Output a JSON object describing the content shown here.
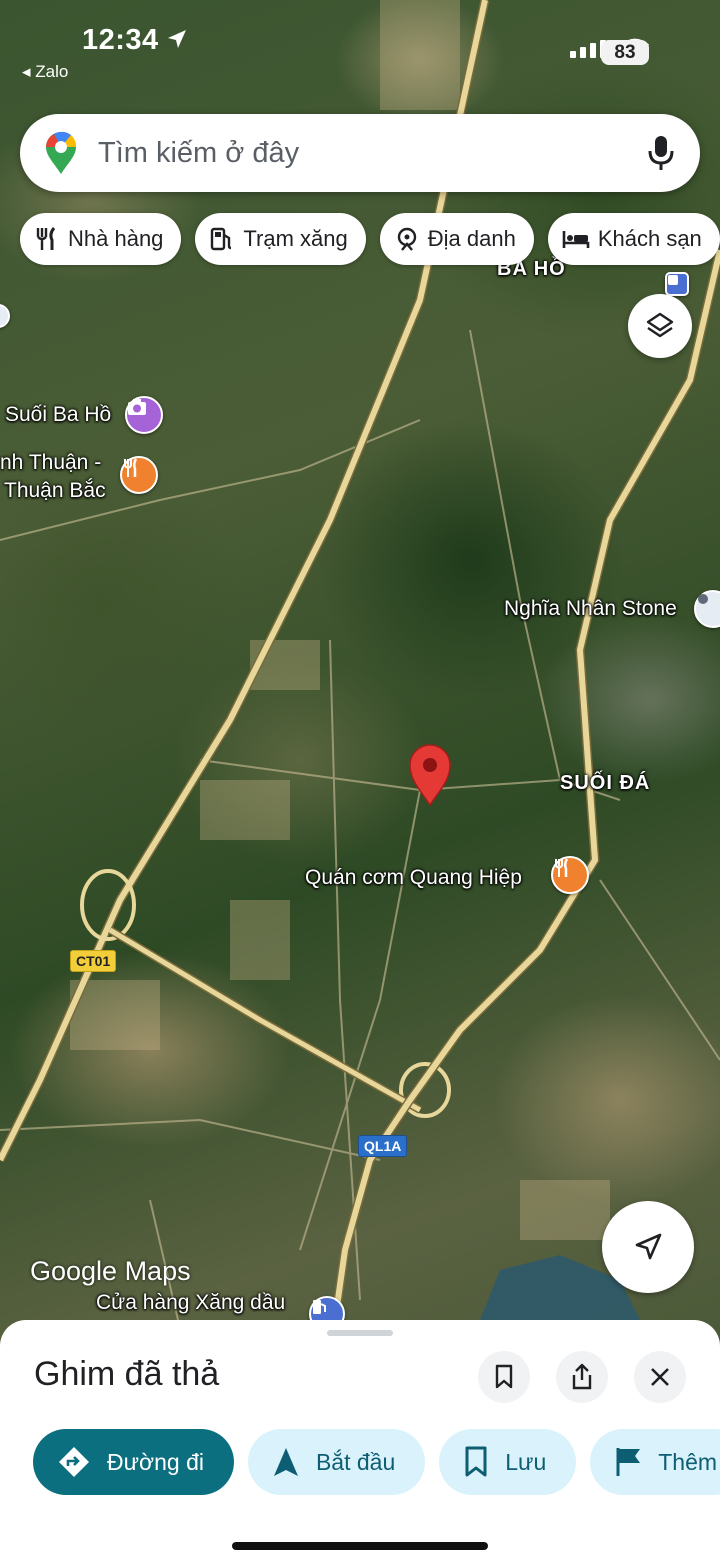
{
  "status_bar": {
    "time": "12:34",
    "back_app": "◂ Zalo",
    "battery": "83"
  },
  "search": {
    "placeholder": "Tìm kiếm ở đây"
  },
  "chips": [
    {
      "label": "Nhà hàng",
      "icon": "fork-knife-icon"
    },
    {
      "label": "Trạm xăng",
      "icon": "gas-pump-icon"
    },
    {
      "label": "Địa danh",
      "icon": "landmark-icon"
    },
    {
      "label": "Khách sạn",
      "icon": "bed-icon"
    }
  ],
  "map": {
    "labels": {
      "ba_ho": "BA HỒ",
      "suoi_ba_ho": "Suối Ba Hồ",
      "nh_thuan": "nh Thuận -",
      "thuan_bac": "Thuận Bắc",
      "nghia_nhan_stone": "Nghĩa Nhân Stone",
      "suoi_da": "SUỐI ĐÁ",
      "quan_com": "Quán cơm Quang Hiệp",
      "cua_hang": "Cửa hàng Xăng dầu"
    },
    "shields": {
      "ct01": "CT01",
      "ql1a": "QL1A"
    },
    "logo": "Google Maps",
    "colors": {
      "pin": "#e53935",
      "road": "#e8d79a"
    }
  },
  "sheet": {
    "title": "Ghim đã thả",
    "actions": [
      {
        "label": "Đường đi",
        "icon": "directions-icon"
      },
      {
        "label": "Bắt đầu",
        "icon": "navigation-arrow-icon"
      },
      {
        "label": "Lưu",
        "icon": "bookmark-icon"
      },
      {
        "label": "Thêm",
        "icon": "flag-icon"
      }
    ]
  }
}
